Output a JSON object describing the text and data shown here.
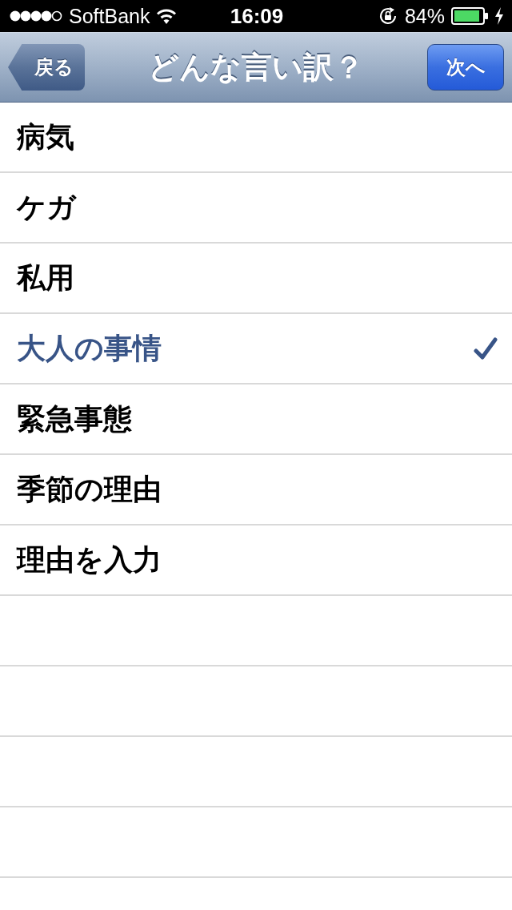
{
  "status_bar": {
    "carrier": "SoftBank",
    "time": "16:09",
    "battery": "84%"
  },
  "nav_bar": {
    "back_button": "戻る",
    "title": "どんな言い訳？",
    "next_button": "次へ"
  },
  "items": [
    {
      "label": "病気",
      "selected": false
    },
    {
      "label": "ケガ",
      "selected": false
    },
    {
      "label": "私用",
      "selected": false
    },
    {
      "label": "大人の事情",
      "selected": true
    },
    {
      "label": "緊急事態",
      "selected": false
    },
    {
      "label": "季節の理由",
      "selected": false
    },
    {
      "label": "理由を入力",
      "selected": false
    }
  ]
}
